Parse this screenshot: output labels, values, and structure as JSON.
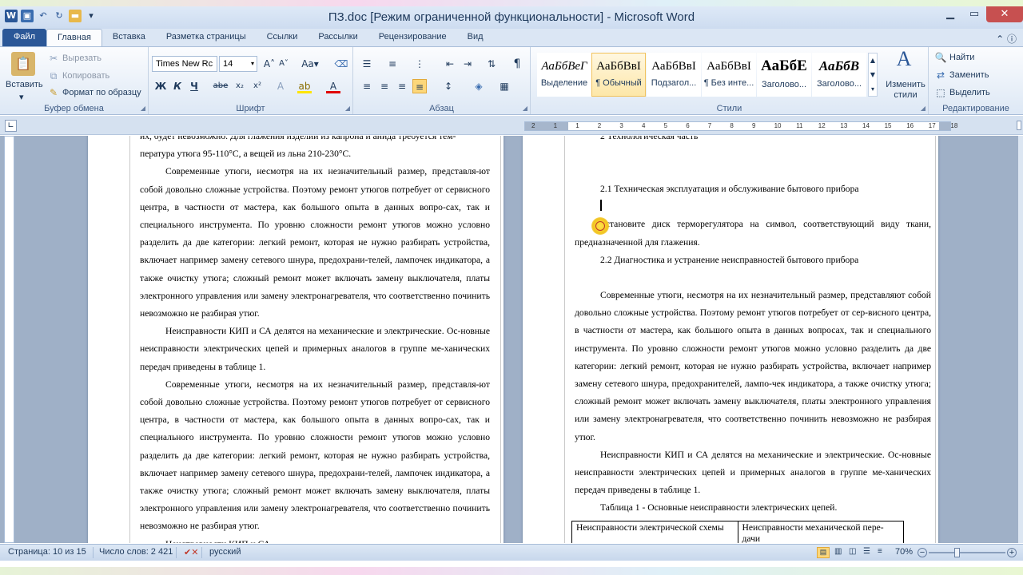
{
  "window": {
    "title": "ПЗ.doc [Режим ограниченной функциональности]  -  Microsoft Word",
    "minimize": "▁",
    "maximize": "▭",
    "close": "✕"
  },
  "tabs": [
    "Файл",
    "Главная",
    "Вставка",
    "Разметка страницы",
    "Ссылки",
    "Рассылки",
    "Рецензирование",
    "Вид"
  ],
  "ribbon": {
    "clipboard": {
      "label": "Буфер обмена",
      "paste": "Вставить",
      "cut": "Вырезать",
      "copy": "Копировать",
      "format_painter": "Формат по образцу"
    },
    "font": {
      "label": "Шрифт",
      "name": "Times New Rc",
      "size": "14",
      "bold": "Ж",
      "italic": "К",
      "underline": "Ч",
      "strike": "abe",
      "sub": "x₂",
      "sup": "x²",
      "grow": "A",
      "shrink": "A",
      "case": "Aa"
    },
    "paragraph": {
      "label": "Абзац",
      "pilcrow": "¶"
    },
    "styles": {
      "label": "Стили",
      "change_styles": "Изменить стили",
      "items": [
        {
          "sample": "АаБбВеГ",
          "name": "Выделение"
        },
        {
          "sample": "АаБбВвІ",
          "name": "¶ Обычный"
        },
        {
          "sample": "АаБбВвІ",
          "name": "Подзагол..."
        },
        {
          "sample": "АаБбВвІ",
          "name": "¶ Без инте..."
        },
        {
          "sample": "АаБбЕ",
          "name": "Заголово..."
        },
        {
          "sample": "АаБбВ",
          "name": "Заголово..."
        }
      ]
    },
    "editing": {
      "label": "Редактирование",
      "find": "Найти",
      "replace": "Заменить",
      "select": "Выделить"
    }
  },
  "ruler": [
    "2",
    "1",
    "1",
    "2",
    "3",
    "4",
    "5",
    "6",
    "7",
    "8",
    "9",
    "10",
    "11",
    "12",
    "13",
    "14",
    "15",
    "16",
    "17",
    "18"
  ],
  "left_page": {
    "top_line": "их, будет невозможно. Для глажения изделий из капрона и анида требуется тем-",
    "line2": "пература утюга 95-110°С, а вещей из льна 210-230°С.",
    "para1": "Современные утюги, несмотря на их незначительный размер, представля-ют собой довольно сложные устройства. Поэтому ремонт утюгов потребует от сервисного центра, в частности от мастера, как большого опыта в данных вопро-сах, так и специального инструмента. По уровню сложности ремонт утюгов можно условно разделить да две категории: легкий ремонт, которая не нужно разбирать устройства, включает например замену сетевого шнура, предохрани-телей, лампочек индикатора, а также очистку утюга; сложный ремонт может включать замену выключателя, платы электронного управления или замену электронагревателя, что соответственно починить невозможно не разбирая утюг.",
    "para2": "Неисправности КИП и СА делятся на механические и электрические. Ос-новные неисправности электрических цепей и примерных аналогов в группе ме-ханических передач приведены в таблице 1.",
    "para3": "Современные утюги, несмотря на их незначительный размер, представля-ют собой довольно сложные устройства. Поэтому ремонт утюгов потребует от сервисного центра, в частности от мастера, как большого опыта в данных вопро-сах, так и специального инструмента. По уровню сложности ремонт утюгов можно условно разделить да две категории: легкий ремонт, которая не нужно разбирать устройства, включает например замену сетевого шнура, предохрани-телей, лампочек индикатора, а также очистку утюга; сложный ремонт может включать замену выключателя, платы электронного управления или замену электронагревателя, что соответственно починить невозможно не разбирая утюг.",
    "bottom": "Неисправности КИП и СА ..."
  },
  "right_page": {
    "heading2": "2 Технологическая часть",
    "heading21": "2.1 Техническая эксплуатация и обслуживание бытового прибора",
    "step": "Установите диск терморегулятора на символ, соответствующий виду ткани, предназначенной для глажения.",
    "heading22": "2.2 Диагностика и устранение неисправностей бытового прибора",
    "para1": "Современные утюги, несмотря на их незначительный размер, представляют собой довольно сложные устройства. Поэтому ремонт утюгов потребует от сер-висного центра, в частности от мастера, как большого опыта в данных вопросах, так и специального инструмента. По уровню сложности ремонт утюгов можно условно разделить да две категории: легкий ремонт, которая не нужно разбирать устройства, включает например замену сетевого шнура, предохранителей, лампо-чек индикатора, а также очистку утюга; сложный ремонт может включать замену выключателя, платы электронного управления или замену электронагревателя, что соответственно починить невозможно не разбирая утюг.",
    "para2": "Неисправности КИП и СА делятся на механические и электрические. Ос-новные неисправности электрических цепей и примерных аналогов в группе ме-ханических передач приведены в таблице 1.",
    "table_caption": "Таблица 1 - Основные неисправности электрических цепей.",
    "table_headers": [
      "Неисправности электрической схемы",
      "Неисправности механической пере-дачи"
    ]
  },
  "status": {
    "page": "Страница: 10 из 15",
    "words": "Число слов: 2 421",
    "language": "русский",
    "zoom": "70%",
    "zoom_out": "−",
    "zoom_in": "+"
  },
  "colors": {
    "file_tab": "#2b5797",
    "close": "#c75050",
    "accent": "#f2c25b"
  }
}
